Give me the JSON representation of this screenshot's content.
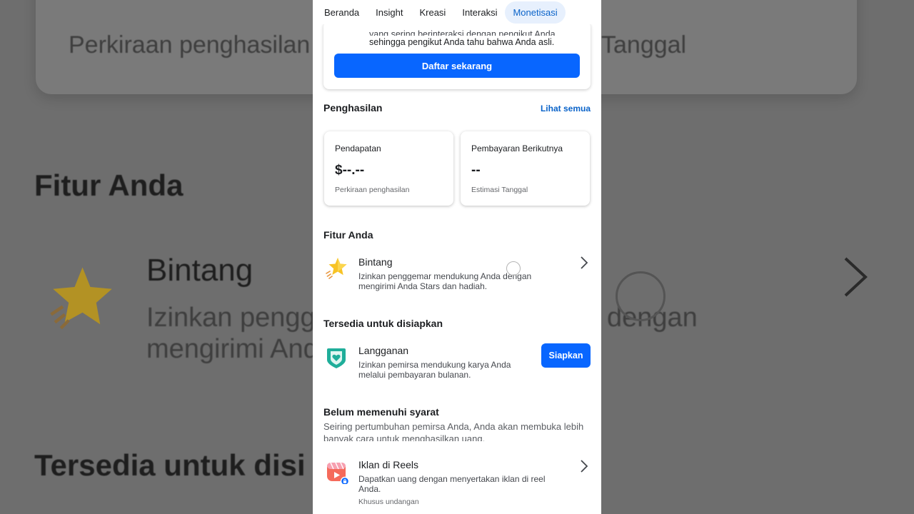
{
  "tabs": [
    {
      "label": "Beranda",
      "active": false
    },
    {
      "label": "Insight",
      "active": false
    },
    {
      "label": "Kreasi",
      "active": false
    },
    {
      "label": "Interaksi",
      "active": false
    },
    {
      "label": "Monetisasi",
      "active": true
    }
  ],
  "verify_card": {
    "text_line1": "yang sering berinteraksi dengan pengikut Anda,",
    "text_line2": "sehingga pengikut Anda tahu bahwa Anda asli.",
    "button_label": "Daftar sekarang"
  },
  "earnings": {
    "title": "Penghasilan",
    "see_all": "Lihat semua",
    "cards": [
      {
        "label": "Pendapatan",
        "value": "$--.--",
        "sub": "Perkiraan penghasilan"
      },
      {
        "label": "Pembayaran Berikutnya",
        "value": "--",
        "sub": "Estimasi Tanggal"
      }
    ]
  },
  "features": {
    "title": "Fitur Anda",
    "items": [
      {
        "title": "Bintang",
        "desc": "Izinkan penggemar mendukung Anda dengan mengirimi Anda Stars dan hadiah.",
        "icon": "star-icon"
      }
    ]
  },
  "available": {
    "title": "Tersedia untuk disiapkan",
    "items": [
      {
        "title": "Langganan",
        "desc": "Izinkan pemirsa mendukung karya Anda melalui pembayaran bulanan.",
        "button_label": "Siapkan",
        "icon": "heart-shield-icon"
      }
    ]
  },
  "ineligible": {
    "title": "Belum memenuhi syarat",
    "note": "Seiring pertumbuhan pemirsa Anda, Anda akan membuka lebih banyak cara untuk menghasilkan uang.",
    "items": [
      {
        "title": "Iklan di Reels",
        "desc": "Dapatkan uang dengan menyertakan iklan di reel Anda.",
        "tag": "Khusus undangan",
        "icon": "reels-ads-icon"
      }
    ]
  },
  "background": {
    "est_left": "Perkiraan penghasilan",
    "est_right": "Tanggal",
    "fitur": "Fitur Anda",
    "bintang": "Bintang",
    "desc1": "Izinkan pengg",
    "desc1_right": "dengan",
    "desc2": "mengirimi And",
    "tersedia": "Tersedia untuk disi"
  },
  "colors": {
    "primary": "#0866ff",
    "link": "#0a63c9",
    "active_tab_bg": "#e7f0fd"
  }
}
